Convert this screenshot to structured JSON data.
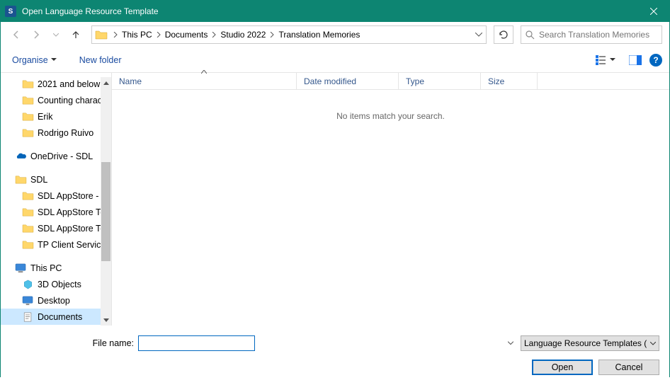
{
  "window": {
    "title": "Open Language Resource Template"
  },
  "breadcrumb": {
    "items": [
      "This PC",
      "Documents",
      "Studio 2022",
      "Translation Memories"
    ]
  },
  "search": {
    "placeholder": "Search Translation Memories"
  },
  "toolbar": {
    "organise": "Organise",
    "new_folder": "New folder"
  },
  "tree": {
    "items": [
      {
        "label": "2021 and below",
        "type": "folder",
        "indent": 2
      },
      {
        "label": "Counting characters",
        "type": "folder",
        "indent": 2
      },
      {
        "label": "Erik",
        "type": "folder",
        "indent": 2
      },
      {
        "label": "Rodrigo Ruivo",
        "type": "folder",
        "indent": 2
      },
      {
        "label": "OneDrive - SDL",
        "type": "onedrive",
        "heading": true
      },
      {
        "label": "SDL",
        "type": "folder",
        "heading": true
      },
      {
        "label": "SDL AppStore - Develop",
        "type": "folder",
        "indent": 2
      },
      {
        "label": "SDL AppStore Team",
        "type": "folder",
        "indent": 2
      },
      {
        "label": "SDL AppStore Team",
        "type": "folder",
        "indent": 2
      },
      {
        "label": "TP Client Services",
        "type": "folder",
        "indent": 2
      },
      {
        "label": "This PC",
        "type": "thispc",
        "heading": true
      },
      {
        "label": "3D Objects",
        "type": "3d",
        "indent": 2
      },
      {
        "label": "Desktop",
        "type": "desktop",
        "indent": 2
      },
      {
        "label": "Documents",
        "type": "documents",
        "indent": 2,
        "selected": true
      }
    ]
  },
  "columns": {
    "name": "Name",
    "date": "Date modified",
    "type": "Type",
    "size": "Size"
  },
  "list": {
    "empty": "No items match your search."
  },
  "footer": {
    "filename_label": "File name:",
    "filetype": "Language Resource Templates (",
    "open": "Open",
    "cancel": "Cancel"
  }
}
